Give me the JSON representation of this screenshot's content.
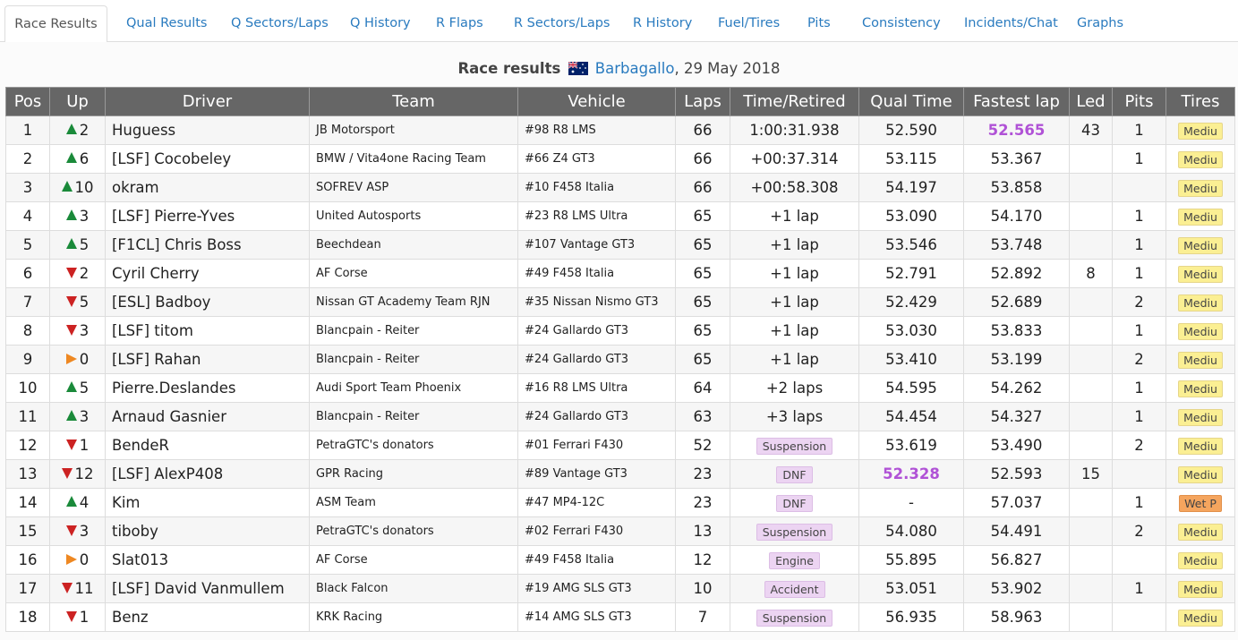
{
  "tabs": [
    {
      "label": "Race Results",
      "active": true
    },
    {
      "label": "Qual Results"
    },
    {
      "label": "Q Sectors/Laps"
    },
    {
      "label": "Q History"
    },
    {
      "label": "R Flaps"
    },
    {
      "label": "R Sectors/Laps"
    },
    {
      "label": "R History"
    },
    {
      "label": "Fuel/Tires"
    },
    {
      "label": "Pits"
    },
    {
      "label": "Consistency"
    },
    {
      "label": "Incidents/Chat"
    },
    {
      "label": "Graphs"
    }
  ],
  "title": {
    "prefix": "Race results",
    "flag_icon": "australia-flag-icon",
    "track": "Barbagallo",
    "date": ", 29 May 2018"
  },
  "columns": [
    "Pos",
    "Up",
    "Driver",
    "Team",
    "Vehicle",
    "Laps",
    "Time/Retired",
    "Qual Time",
    "Fastest lap",
    "Led",
    "Pits",
    "Tires"
  ],
  "colors": {
    "header_bg": "#666666",
    "link": "#2a7bbf",
    "best": "#b052d6",
    "gain": "#1a8a3a",
    "loss": "#cc2222",
    "same": "#ee8822"
  },
  "rows": [
    {
      "pos": "1",
      "dir": "up",
      "up": "2",
      "driver": "Huguess",
      "team": "JB Motorsport",
      "vehicle": "#98 R8 LMS",
      "laps": "66",
      "time": "1:00:31.938",
      "time_status": false,
      "qual": "52.590",
      "qual_best": false,
      "fastest": "52.565",
      "fastest_best": true,
      "led": "43",
      "pits": "1",
      "tire": "Mediu"
    },
    {
      "pos": "2",
      "dir": "up",
      "up": "6",
      "driver": "[LSF] Cocobeley",
      "team": "BMW / Vita4one Racing Team",
      "vehicle": "#66 Z4 GT3",
      "laps": "66",
      "time": "+00:37.314",
      "time_status": false,
      "qual": "53.115",
      "qual_best": false,
      "fastest": "53.367",
      "fastest_best": false,
      "led": "",
      "pits": "1",
      "tire": "Mediu"
    },
    {
      "pos": "3",
      "dir": "up",
      "up": "10",
      "driver": "okram",
      "team": "SOFREV ASP",
      "vehicle": "#10 F458 Italia",
      "laps": "66",
      "time": "+00:58.308",
      "time_status": false,
      "qual": "54.197",
      "qual_best": false,
      "fastest": "53.858",
      "fastest_best": false,
      "led": "",
      "pits": "",
      "tire": "Mediu"
    },
    {
      "pos": "4",
      "dir": "up",
      "up": "3",
      "driver": "[LSF] Pierre-Yves",
      "team": "United Autosports",
      "vehicle": "#23 R8 LMS Ultra",
      "laps": "65",
      "time": "+1 lap",
      "time_status": false,
      "qual": "53.090",
      "qual_best": false,
      "fastest": "54.170",
      "fastest_best": false,
      "led": "",
      "pits": "1",
      "tire": "Mediu"
    },
    {
      "pos": "5",
      "dir": "up",
      "up": "5",
      "driver": "[F1CL] Chris Boss",
      "team": "Beechdean",
      "vehicle": "#107 Vantage GT3",
      "laps": "65",
      "time": "+1 lap",
      "time_status": false,
      "qual": "53.546",
      "qual_best": false,
      "fastest": "53.748",
      "fastest_best": false,
      "led": "",
      "pits": "1",
      "tire": "Mediu"
    },
    {
      "pos": "6",
      "dir": "down",
      "up": "2",
      "driver": "Cyril Cherry",
      "team": "AF Corse",
      "vehicle": "#49 F458 Italia",
      "laps": "65",
      "time": "+1 lap",
      "time_status": false,
      "qual": "52.791",
      "qual_best": false,
      "fastest": "52.892",
      "fastest_best": false,
      "led": "8",
      "pits": "1",
      "tire": "Mediu"
    },
    {
      "pos": "7",
      "dir": "down",
      "up": "5",
      "driver": "[ESL] Badboy",
      "team": "Nissan GT Academy Team RJN",
      "vehicle": "#35 Nissan Nismo GT3",
      "laps": "65",
      "time": "+1 lap",
      "time_status": false,
      "qual": "52.429",
      "qual_best": false,
      "fastest": "52.689",
      "fastest_best": false,
      "led": "",
      "pits": "2",
      "tire": "Mediu"
    },
    {
      "pos": "8",
      "dir": "down",
      "up": "3",
      "driver": "[LSF] titom",
      "team": "Blancpain - Reiter",
      "vehicle": "#24 Gallardo GT3",
      "laps": "65",
      "time": "+1 lap",
      "time_status": false,
      "qual": "53.030",
      "qual_best": false,
      "fastest": "53.833",
      "fastest_best": false,
      "led": "",
      "pits": "1",
      "tire": "Mediu"
    },
    {
      "pos": "9",
      "dir": "same",
      "up": "0",
      "driver": "[LSF] Rahan",
      "team": "Blancpain - Reiter",
      "vehicle": "#24 Gallardo GT3",
      "laps": "65",
      "time": "+1 lap",
      "time_status": false,
      "qual": "53.410",
      "qual_best": false,
      "fastest": "53.199",
      "fastest_best": false,
      "led": "",
      "pits": "2",
      "tire": "Mediu"
    },
    {
      "pos": "10",
      "dir": "up",
      "up": "5",
      "driver": "Pierre.Deslandes",
      "team": "Audi Sport Team Phoenix",
      "vehicle": "#16 R8 LMS Ultra",
      "laps": "64",
      "time": "+2 laps",
      "time_status": false,
      "qual": "54.595",
      "qual_best": false,
      "fastest": "54.262",
      "fastest_best": false,
      "led": "",
      "pits": "1",
      "tire": "Mediu"
    },
    {
      "pos": "11",
      "dir": "up",
      "up": "3",
      "driver": "Arnaud Gasnier",
      "team": "Blancpain - Reiter",
      "vehicle": "#24 Gallardo GT3",
      "laps": "63",
      "time": "+3 laps",
      "time_status": false,
      "qual": "54.454",
      "qual_best": false,
      "fastest": "54.327",
      "fastest_best": false,
      "led": "",
      "pits": "1",
      "tire": "Mediu"
    },
    {
      "pos": "12",
      "dir": "down",
      "up": "1",
      "driver": "BendeR",
      "team": "PetraGTC's donators",
      "vehicle": "#01 Ferrari F430",
      "laps": "52",
      "time": "Suspension",
      "time_status": true,
      "qual": "53.619",
      "qual_best": false,
      "fastest": "53.490",
      "fastest_best": false,
      "led": "",
      "pits": "2",
      "tire": "Mediu"
    },
    {
      "pos": "13",
      "dir": "down",
      "up": "12",
      "driver": "[LSF] AlexP408",
      "team": "GPR Racing",
      "vehicle": "#89 Vantage GT3",
      "laps": "23",
      "time": "DNF",
      "time_status": true,
      "qual": "52.328",
      "qual_best": true,
      "fastest": "52.593",
      "fastest_best": false,
      "led": "15",
      "pits": "",
      "tire": "Mediu"
    },
    {
      "pos": "14",
      "dir": "up",
      "up": "4",
      "driver": "Kim",
      "team": "ASM Team",
      "vehicle": "#47 MP4-12C",
      "laps": "23",
      "time": "DNF",
      "time_status": true,
      "qual": "-",
      "qual_best": false,
      "fastest": "57.037",
      "fastest_best": false,
      "led": "",
      "pits": "1",
      "tire": "Wet P",
      "tire_wet": true
    },
    {
      "pos": "15",
      "dir": "down",
      "up": "3",
      "driver": "tiboby",
      "team": "PetraGTC's donators",
      "vehicle": "#02 Ferrari F430",
      "laps": "13",
      "time": "Suspension",
      "time_status": true,
      "qual": "54.080",
      "qual_best": false,
      "fastest": "54.491",
      "fastest_best": false,
      "led": "",
      "pits": "2",
      "tire": "Mediu"
    },
    {
      "pos": "16",
      "dir": "same",
      "up": "0",
      "driver": "Slat013",
      "team": "AF Corse",
      "vehicle": "#49 F458 Italia",
      "laps": "12",
      "time": "Engine",
      "time_status": true,
      "qual": "55.895",
      "qual_best": false,
      "fastest": "56.827",
      "fastest_best": false,
      "led": "",
      "pits": "",
      "tire": "Mediu"
    },
    {
      "pos": "17",
      "dir": "down",
      "up": "11",
      "driver": "[LSF] David Vanmullem",
      "team": "Black Falcon",
      "vehicle": "#19 AMG SLS GT3",
      "laps": "10",
      "time": "Accident",
      "time_status": true,
      "qual": "53.051",
      "qual_best": false,
      "fastest": "53.902",
      "fastest_best": false,
      "led": "",
      "pits": "1",
      "tire": "Mediu"
    },
    {
      "pos": "18",
      "dir": "down",
      "up": "1",
      "driver": "Benz",
      "team": "KRK Racing",
      "vehicle": "#14 AMG SLS GT3",
      "laps": "7",
      "time": "Suspension",
      "time_status": true,
      "qual": "56.935",
      "qual_best": false,
      "fastest": "58.963",
      "fastest_best": false,
      "led": "",
      "pits": "",
      "tire": "Mediu"
    }
  ]
}
